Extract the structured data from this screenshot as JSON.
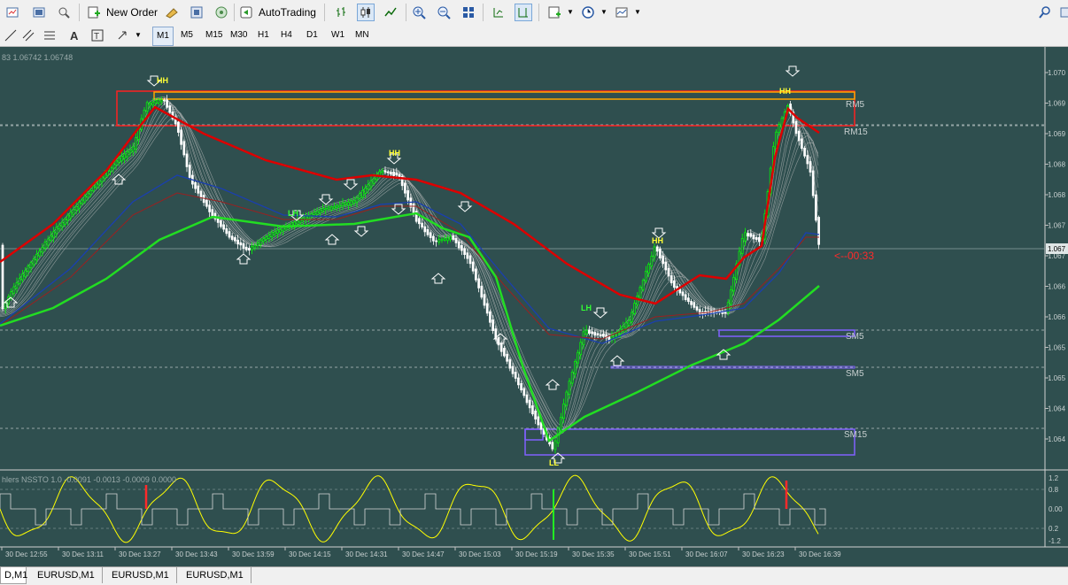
{
  "toolbar": {
    "new_order_label": "New Order",
    "autotrading_label": "AutoTrading"
  },
  "timeframes": [
    "M1",
    "M5",
    "M15",
    "M30",
    "H1",
    "H4",
    "D1",
    "W1",
    "MN"
  ],
  "active_timeframe": "M1",
  "chart": {
    "header_text": "83 1.06742 1.06748",
    "indicator_header": "hlers NSSTO 1.0 -0.0091 -0.0013 -0.0009 0.0000",
    "countdown": "<--00:33",
    "price_axis": [
      "1.070",
      "1.069",
      "1.069",
      "1.068",
      "1.068",
      "1.067",
      "1.067",
      "1.066",
      "1.066",
      "1.065",
      "1.065",
      "1.064",
      "1.064"
    ],
    "indicator_axis": [
      "1.2",
      "0.8",
      "0.00",
      "0.2",
      "-1.2"
    ],
    "time_axis": [
      "30 Dec 12:55",
      "30 Dec 13:11",
      "30 Dec 13:27",
      "30 Dec 13:43",
      "30 Dec 13:59",
      "30 Dec 14:15",
      "30 Dec 14:31",
      "30 Dec 14:47",
      "30 Dec 15:03",
      "30 Dec 15:19",
      "30 Dec 15:35",
      "30 Dec 15:51",
      "30 Dec 16:07",
      "30 Dec 16:23",
      "30 Dec 16:39"
    ],
    "zone_labels": {
      "rm5": "RM5",
      "rm15": "RM15",
      "sm5_a": "SM5",
      "sm5_b": "SM5",
      "sm15": "SM15"
    },
    "swing_labels": {
      "hh1": "HH",
      "hh2": "HH",
      "hh3": "HH",
      "hh4": "HH",
      "lh1": "LH",
      "lh2": "LH",
      "ll": "LL"
    },
    "current_price_label": "1.067",
    "colors": {
      "background": "#2f4f4f",
      "bull": "#00ff00",
      "bear": "#ffffff",
      "ma_red": "#dd0000",
      "ma_green": "#22dd22",
      "ma_blue": "#1a3fb0",
      "resistance": "#ff2020",
      "supply_box": "#ffa500",
      "support_box": "#8060ff",
      "oscillator": "#ffff00"
    }
  },
  "tabs": [
    "D,M1",
    "EURUSD,M1",
    "EURUSD,M1",
    "EURUSD,M1"
  ]
}
